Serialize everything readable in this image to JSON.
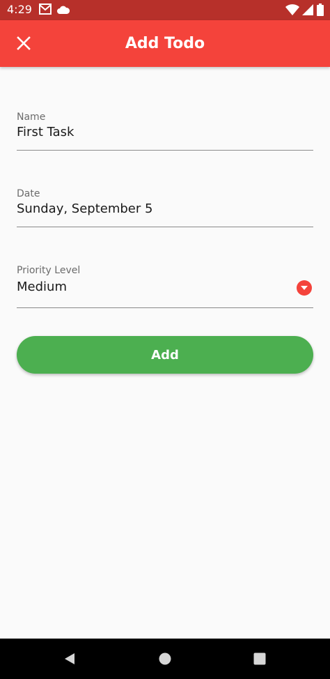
{
  "status_bar": {
    "time": "4:29",
    "icons": [
      "gmail-icon",
      "cloud-icon",
      "wifi-icon",
      "signal-icon",
      "battery-icon"
    ]
  },
  "app_bar": {
    "title": "Add Todo",
    "close_icon": "close-icon"
  },
  "form": {
    "name": {
      "label": "Name",
      "value": "First Task"
    },
    "date": {
      "label": "Date",
      "value": "Sunday, September 5"
    },
    "priority": {
      "label": "Priority Level",
      "value": "Medium"
    }
  },
  "add_button": {
    "label": "Add"
  },
  "colors": {
    "app_bar": "#f4433b",
    "status_bar": "#b7302a",
    "add_button": "#4caf50",
    "background": "#fafafa"
  },
  "nav_bar": {
    "icons": [
      "back-icon",
      "home-icon",
      "recents-icon"
    ]
  }
}
